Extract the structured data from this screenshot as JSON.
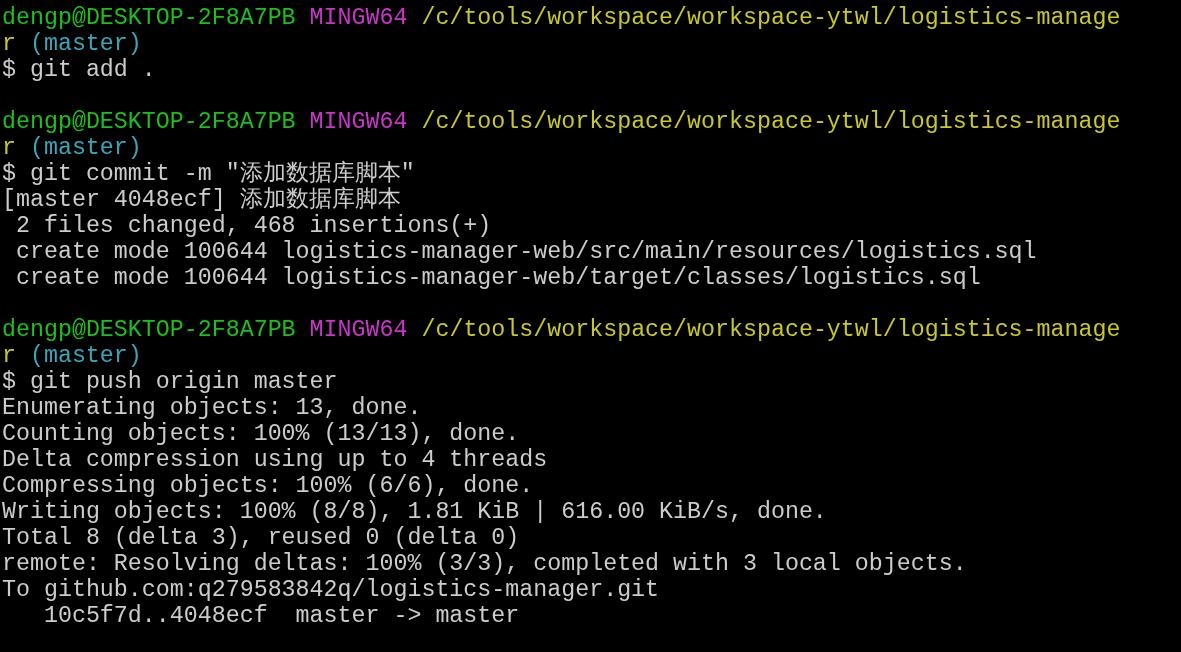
{
  "terminal": {
    "blocks": [
      {
        "prompt": {
          "user": "dengp@DESKTOP-2F8A7PB",
          "system": "MINGW64",
          "path_lines": [
            "/c/tools/workspace/workspace-ytwl/logistics-manage",
            "r"
          ],
          "branch": "(master)"
        },
        "command": "$ git add ."
      },
      {
        "prompt": {
          "user": "dengp@DESKTOP-2F8A7PB",
          "system": "MINGW64",
          "path_lines": [
            "/c/tools/workspace/workspace-ytwl/logistics-manage",
            "r"
          ],
          "branch": "(master)"
        },
        "command": "$ git commit -m \"添加数据库脚本\"",
        "output": [
          "[master 4048ecf] 添加数据库脚本",
          " 2 files changed, 468 insertions(+)",
          " create mode 100644 logistics-manager-web/src/main/resources/logistics.sql",
          " create mode 100644 logistics-manager-web/target/classes/logistics.sql"
        ]
      },
      {
        "prompt": {
          "user": "dengp@DESKTOP-2F8A7PB",
          "system": "MINGW64",
          "path_lines": [
            "/c/tools/workspace/workspace-ytwl/logistics-manage",
            "r"
          ],
          "branch": "(master)"
        },
        "command": "$ git push origin master",
        "output": [
          "Enumerating objects: 13, done.",
          "Counting objects: 100% (13/13), done.",
          "Delta compression using up to 4 threads",
          "Compressing objects: 100% (6/6), done.",
          "Writing objects: 100% (8/8), 1.81 KiB | 616.00 KiB/s, done.",
          "Total 8 (delta 3), reused 0 (delta 0)",
          "remote: Resolving deltas: 100% (3/3), completed with 3 local objects.",
          "To github.com:q279583842q/logistics-manager.git",
          "   10c5f7d..4048ecf  master -> master"
        ]
      }
    ]
  }
}
